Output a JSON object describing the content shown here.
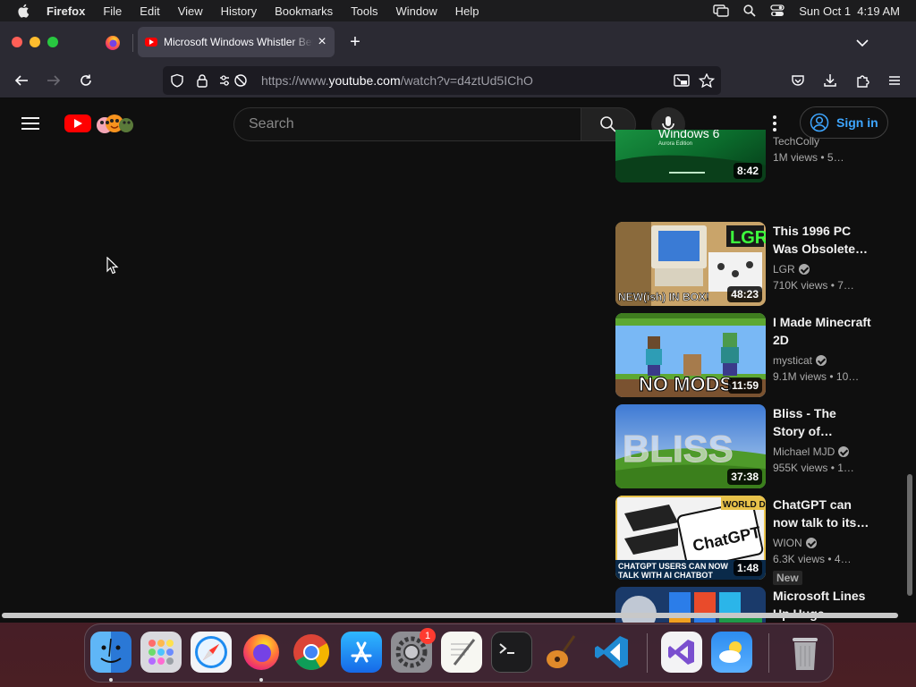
{
  "menubar": {
    "apple_icon": "apple-logo-icon",
    "app_name": "Firefox",
    "menus": [
      "File",
      "Edit",
      "View",
      "History",
      "Bookmarks",
      "Tools",
      "Window",
      "Help"
    ],
    "status_icons": [
      "screen-mirroring-icon",
      "spotlight-search-icon",
      "control-center-icon"
    ],
    "clock": "Sun Oct 1  4:19 AM"
  },
  "browser": {
    "pinned_tab_icon": "firefox-icon",
    "active_tab": {
      "title": "Microsoft Windows Whistler Beta",
      "favicon": "youtube-favicon-icon",
      "close_label": "×"
    },
    "new_tab_label": "+",
    "url": {
      "prefix": "https://www.",
      "domain": "youtube.com",
      "path": "/watch?v=d4ztUd5IChO"
    },
    "url_icons": [
      "shield-icon",
      "lock-icon",
      "permissions-icon"
    ],
    "toolbar_icons": [
      "picture-in-picture-icon",
      "bookmark-star-icon",
      "pocket-icon",
      "downloads-icon",
      "extensions-icon",
      "menu-icon"
    ]
  },
  "youtube": {
    "search_placeholder": "Search",
    "sign_in_label": "Sign in",
    "colors": {
      "accent": "#3ea6ff",
      "brand": "#ff0000",
      "background": "#0f0f0f"
    },
    "recommendations": [
      {
        "title": "",
        "channel": "TechColly",
        "verified": false,
        "views": "1M views",
        "age": "5…",
        "duration": "8:42",
        "new": false,
        "thumb_text": "Windows 6 Aurora Edition"
      },
      {
        "title": "This 1996 PC Was Obsolete…",
        "channel": "LGR",
        "verified": true,
        "views": "710K views",
        "age": "7…",
        "duration": "48:23",
        "new": false,
        "thumb_text": "NEW(ish) IN BOX!"
      },
      {
        "title": "I Made Minecraft 2D",
        "channel": "mysticat",
        "verified": true,
        "views": "9.1M views",
        "age": "10…",
        "duration": "11:59",
        "new": false,
        "thumb_text": "NO MODS"
      },
      {
        "title": "Bliss - The Story of…",
        "channel": "Michael MJD",
        "verified": true,
        "views": "955K views",
        "age": "1…",
        "duration": "37:38",
        "new": false,
        "thumb_text": "BLISS"
      },
      {
        "title": "ChatGPT can now talk to its…",
        "channel": "WION",
        "verified": true,
        "views": "6.3K views",
        "age": "4…",
        "duration": "1:48",
        "new": true,
        "new_label": "New",
        "thumb_text": "WORLD DNA ChatGPT CHATGPT USERS CAN NOW TALK WITH AI CHATBOT"
      },
      {
        "title": "Microsoft Lines Up Huge…",
        "channel": "",
        "verified": false,
        "views": "",
        "age": "",
        "duration": "",
        "new": false,
        "thumb_text": ""
      }
    ]
  },
  "dock": {
    "apps": [
      {
        "name": "finder-icon",
        "running": true
      },
      {
        "name": "launchpad-icon",
        "running": false
      },
      {
        "name": "safari-icon",
        "running": false
      },
      {
        "name": "firefox-icon",
        "running": true
      },
      {
        "name": "chrome-icon",
        "running": false
      },
      {
        "name": "app-store-icon",
        "running": false
      },
      {
        "name": "system-settings-icon",
        "running": false,
        "badge": "1"
      },
      {
        "name": "textedit-icon",
        "running": false
      },
      {
        "name": "terminal-icon",
        "running": false
      },
      {
        "name": "garageband-icon",
        "running": false
      },
      {
        "name": "vscode-icon",
        "running": false
      },
      {
        "name": "visual-studio-icon",
        "running": false
      },
      {
        "name": "weather-icon",
        "running": false
      },
      {
        "name": "trash-icon",
        "running": false
      }
    ]
  }
}
